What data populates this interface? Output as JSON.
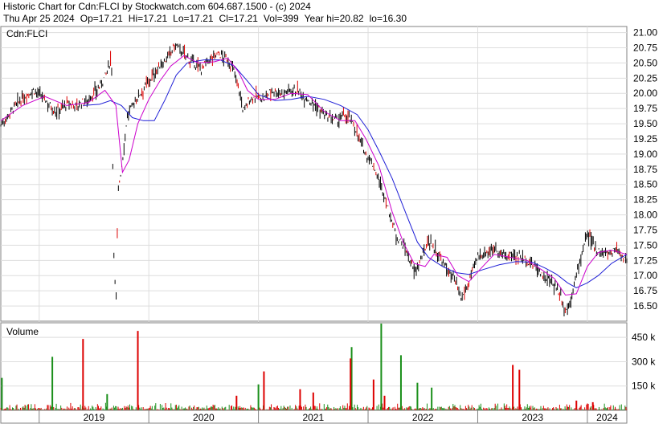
{
  "header": {
    "title": "Historic Chart for Cdn:FLCI by Stockwatch.com 604.687.1500 - (c) 2024",
    "quote": {
      "date": "Thu Apr 25 2024",
      "open": "Op=17.21",
      "high": "Hi=17.21",
      "low": "Lo=17.21",
      "close": "Cl=17.21",
      "volume": "Vol=399",
      "year_high": "Year hi=20.82",
      "year_low": "lo=16.30"
    }
  },
  "colors": {
    "up": "#1a8f1a",
    "down": "#dd0000",
    "bar": "#000000",
    "ma_fast": "#cc00cc",
    "ma_slow": "#1f1fd6",
    "grid": "#dddddd",
    "frame": "#808080"
  },
  "chart_data": [
    {
      "type": "line",
      "panel_label": "Cdn:FLCI",
      "ylim": [
        16.25,
        21.1
      ],
      "yticks": [
        "21.00",
        "20.75",
        "20.50",
        "20.25",
        "20.00",
        "19.75",
        "19.50",
        "19.25",
        "19.00",
        "18.75",
        "18.50",
        "18.25",
        "18.00",
        "17.75",
        "17.50",
        "17.25",
        "17.00",
        "16.75",
        "16.50"
      ],
      "x_years": [
        "2019",
        "2020",
        "2021",
        "2022",
        "2023",
        "2024"
      ],
      "x_domain": [
        2018.65,
        2024.36
      ],
      "year_starts": [
        2019,
        2020,
        2021,
        2022,
        2023,
        2024
      ],
      "price_path": [
        [
          2018.65,
          19.48
        ],
        [
          2018.75,
          19.72
        ],
        [
          2018.85,
          19.92
        ],
        [
          2018.95,
          20.05
        ],
        [
          2019.05,
          19.9
        ],
        [
          2019.15,
          19.7
        ],
        [
          2019.25,
          19.82
        ],
        [
          2019.35,
          19.8
        ],
        [
          2019.45,
          19.9
        ],
        [
          2019.55,
          20.1
        ],
        [
          2019.62,
          20.35
        ],
        [
          2019.66,
          20.62
        ],
        [
          2019.68,
          17.5
        ],
        [
          2019.7,
          16.45
        ],
        [
          2019.72,
          18.4
        ],
        [
          2019.76,
          18.9
        ],
        [
          2019.8,
          19.6
        ],
        [
          2019.85,
          19.8
        ],
        [
          2019.92,
          20.0
        ],
        [
          2020.0,
          20.2
        ],
        [
          2020.1,
          20.45
        ],
        [
          2020.18,
          20.6
        ],
        [
          2020.24,
          20.8
        ],
        [
          2020.32,
          20.65
        ],
        [
          2020.4,
          20.5
        ],
        [
          2020.48,
          20.4
        ],
        [
          2020.55,
          20.55
        ],
        [
          2020.63,
          20.65
        ],
        [
          2020.72,
          20.55
        ],
        [
          2020.78,
          20.35
        ],
        [
          2020.82,
          20.1
        ],
        [
          2020.86,
          19.7
        ],
        [
          2020.92,
          19.9
        ],
        [
          2020.98,
          19.95
        ],
        [
          2021.05,
          19.9
        ],
        [
          2021.12,
          20.05
        ],
        [
          2021.22,
          20.0
        ],
        [
          2021.32,
          20.08
        ],
        [
          2021.42,
          19.95
        ],
        [
          2021.52,
          19.8
        ],
        [
          2021.62,
          19.6
        ],
        [
          2021.72,
          19.55
        ],
        [
          2021.8,
          19.65
        ],
        [
          2021.88,
          19.45
        ],
        [
          2021.95,
          19.1
        ],
        [
          2022.05,
          18.8
        ],
        [
          2022.15,
          18.3
        ],
        [
          2022.25,
          17.7
        ],
        [
          2022.35,
          17.4
        ],
        [
          2022.42,
          17.05
        ],
        [
          2022.48,
          17.25
        ],
        [
          2022.55,
          17.6
        ],
        [
          2022.62,
          17.4
        ],
        [
          2022.7,
          17.15
        ],
        [
          2022.78,
          16.95
        ],
        [
          2022.85,
          16.6
        ],
        [
          2022.92,
          16.9
        ],
        [
          2023.0,
          17.3
        ],
        [
          2023.08,
          17.4
        ],
        [
          2023.16,
          17.45
        ],
        [
          2023.25,
          17.3
        ],
        [
          2023.35,
          17.35
        ],
        [
          2023.45,
          17.25
        ],
        [
          2023.55,
          17.1
        ],
        [
          2023.62,
          16.95
        ],
        [
          2023.7,
          16.85
        ],
        [
          2023.76,
          16.65
        ],
        [
          2023.8,
          16.4
        ],
        [
          2023.84,
          16.55
        ],
        [
          2023.9,
          17.0
        ],
        [
          2023.96,
          17.45
        ],
        [
          2024.0,
          17.65
        ],
        [
          2024.05,
          17.55
        ],
        [
          2024.1,
          17.4
        ],
        [
          2024.18,
          17.35
        ],
        [
          2024.26,
          17.45
        ],
        [
          2024.32,
          17.32
        ],
        [
          2024.36,
          17.21
        ]
      ],
      "ma_fast_path": [
        [
          2018.65,
          19.55
        ],
        [
          2018.85,
          19.8
        ],
        [
          2019.05,
          19.95
        ],
        [
          2019.25,
          19.8
        ],
        [
          2019.45,
          19.85
        ],
        [
          2019.6,
          20.05
        ],
        [
          2019.7,
          19.8
        ],
        [
          2019.76,
          18.7
        ],
        [
          2019.82,
          18.9
        ],
        [
          2019.9,
          19.5
        ],
        [
          2020.0,
          19.9
        ],
        [
          2020.1,
          20.2
        ],
        [
          2020.2,
          20.45
        ],
        [
          2020.32,
          20.62
        ],
        [
          2020.45,
          20.5
        ],
        [
          2020.6,
          20.52
        ],
        [
          2020.72,
          20.58
        ],
        [
          2020.82,
          20.35
        ],
        [
          2020.9,
          20.05
        ],
        [
          2021.0,
          19.9
        ],
        [
          2021.15,
          19.9
        ],
        [
          2021.3,
          20.0
        ],
        [
          2021.45,
          19.98
        ],
        [
          2021.6,
          19.7
        ],
        [
          2021.75,
          19.55
        ],
        [
          2021.88,
          19.55
        ],
        [
          2021.98,
          19.25
        ],
        [
          2022.1,
          18.8
        ],
        [
          2022.22,
          18.05
        ],
        [
          2022.32,
          17.55
        ],
        [
          2022.42,
          17.2
        ],
        [
          2022.52,
          17.15
        ],
        [
          2022.6,
          17.35
        ],
        [
          2022.72,
          17.3
        ],
        [
          2022.82,
          17.0
        ],
        [
          2022.92,
          16.9
        ],
        [
          2023.02,
          17.1
        ],
        [
          2023.15,
          17.35
        ],
        [
          2023.3,
          17.3
        ],
        [
          2023.45,
          17.25
        ],
        [
          2023.58,
          17.1
        ],
        [
          2023.7,
          16.95
        ],
        [
          2023.8,
          16.68
        ],
        [
          2023.9,
          16.7
        ],
        [
          2024.0,
          17.15
        ],
        [
          2024.1,
          17.38
        ],
        [
          2024.22,
          17.42
        ],
        [
          2024.36,
          17.35
        ]
      ],
      "ma_slow_path": [
        [
          2019.4,
          19.8
        ],
        [
          2019.55,
          19.82
        ],
        [
          2019.65,
          19.88
        ],
        [
          2019.75,
          19.8
        ],
        [
          2019.85,
          19.6
        ],
        [
          2019.95,
          19.55
        ],
        [
          2020.05,
          19.55
        ],
        [
          2020.15,
          19.9
        ],
        [
          2020.25,
          20.3
        ],
        [
          2020.35,
          20.5
        ],
        [
          2020.5,
          20.55
        ],
        [
          2020.65,
          20.55
        ],
        [
          2020.78,
          20.45
        ],
        [
          2020.9,
          20.2
        ],
        [
          2021.0,
          19.98
        ],
        [
          2021.15,
          19.88
        ],
        [
          2021.3,
          19.9
        ],
        [
          2021.45,
          19.95
        ],
        [
          2021.6,
          19.9
        ],
        [
          2021.75,
          19.8
        ],
        [
          2021.9,
          19.65
        ],
        [
          2022.0,
          19.4
        ],
        [
          2022.1,
          19.05
        ],
        [
          2022.22,
          18.6
        ],
        [
          2022.35,
          18.0
        ],
        [
          2022.45,
          17.55
        ],
        [
          2022.55,
          17.3
        ],
        [
          2022.68,
          17.15
        ],
        [
          2022.8,
          17.05
        ],
        [
          2022.92,
          17.02
        ],
        [
          2023.05,
          17.1
        ],
        [
          2023.2,
          17.18
        ],
        [
          2023.35,
          17.23
        ],
        [
          2023.5,
          17.22
        ],
        [
          2023.62,
          17.12
        ],
        [
          2023.72,
          17.02
        ],
        [
          2023.82,
          16.88
        ],
        [
          2023.9,
          16.8
        ],
        [
          2024.0,
          16.88
        ],
        [
          2024.1,
          17.0
        ],
        [
          2024.22,
          17.2
        ],
        [
          2024.36,
          17.35
        ]
      ]
    },
    {
      "type": "bar",
      "panel_label": "Volume",
      "ylim": [
        0,
        540000
      ],
      "yticks": [
        "450 k",
        "300 k",
        "150 k"
      ],
      "ytick_values": [
        450000,
        300000,
        150000
      ],
      "spikes": [
        {
          "x": 2018.66,
          "v": 200000,
          "c": "up"
        },
        {
          "x": 2019.12,
          "v": 330000,
          "c": "up"
        },
        {
          "x": 2019.4,
          "v": 440000,
          "c": "down"
        },
        {
          "x": 2019.62,
          "v": 100000,
          "c": "up"
        },
        {
          "x": 2019.9,
          "v": 490000,
          "c": "down"
        },
        {
          "x": 2020.8,
          "v": 90000,
          "c": "down"
        },
        {
          "x": 2021.0,
          "v": 160000,
          "c": "up"
        },
        {
          "x": 2021.05,
          "v": 240000,
          "c": "down"
        },
        {
          "x": 2021.38,
          "v": 130000,
          "c": "down"
        },
        {
          "x": 2021.5,
          "v": 110000,
          "c": "down"
        },
        {
          "x": 2021.85,
          "v": 390000,
          "c": "up"
        },
        {
          "x": 2021.84,
          "v": 320000,
          "c": "down"
        },
        {
          "x": 2022.05,
          "v": 190000,
          "c": "down"
        },
        {
          "x": 2022.12,
          "v": 560000,
          "c": "up"
        },
        {
          "x": 2022.15,
          "v": 90000,
          "c": "down"
        },
        {
          "x": 2022.3,
          "v": 340000,
          "c": "up"
        },
        {
          "x": 2022.45,
          "v": 170000,
          "c": "up"
        },
        {
          "x": 2022.58,
          "v": 140000,
          "c": "up"
        },
        {
          "x": 2023.32,
          "v": 280000,
          "c": "down"
        },
        {
          "x": 2023.38,
          "v": 250000,
          "c": "down"
        },
        {
          "x": 2023.9,
          "v": 60000,
          "c": "down"
        },
        {
          "x": 2024.05,
          "v": 50000,
          "c": "down"
        }
      ]
    }
  ]
}
